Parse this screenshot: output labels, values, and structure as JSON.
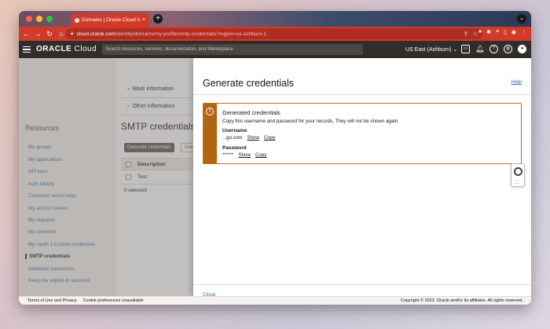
{
  "browser": {
    "tab_title": "Domains | Oracle Cloud Infrastr",
    "new_tab": "+",
    "tab_menu": "⌄",
    "url_host": "cloud.oracle.com",
    "url_path": "/identity/domains/my-profile/smtp-credentials?region=us-ashburn-1"
  },
  "header": {
    "logo_oracle": "ORACLE",
    "logo_cloud": "Cloud",
    "search_placeholder": "Search resources, services, documentation, and Marketplace",
    "region": "US East (Ashburn)"
  },
  "background_page": {
    "accordions": [
      "Work information",
      "Other information"
    ],
    "resources_title": "Resources",
    "sidebar_items": [
      "My groups",
      "My applications",
      "API keys",
      "Auth tokens",
      "Customer secret keys",
      "My access tokens",
      "My requests",
      "My consents",
      "My oauth 2.0 client credentials",
      "SMTP credentials",
      "Database passwords",
      "Keep me signed-in sessions"
    ],
    "active_item": "SMTP credentials",
    "section_title": "SMTP credentials",
    "generate_button": "Generate credentials",
    "delete_button": "Dele",
    "column_description": "Description",
    "row_description": "Test",
    "selected_text": "0 selected"
  },
  "drawer": {
    "title": "Generate credentials",
    "help": "Help",
    "alert": {
      "title": "Generated credentials",
      "description": "Copy this username and password for your records. They will not be shown again.",
      "username_label": "Username",
      "username_value": "...go.com",
      "password_label": "Password",
      "password_value": "******",
      "show": "Show",
      "copy": "Copy"
    },
    "close": "Close"
  },
  "footer": {
    "terms": "Terms of Use and Privacy",
    "cookies": "Cookie preferences unavailable",
    "copyright": "Copyright © 2023, Oracle and/or its affiliates. All rights reserved."
  },
  "colors": {
    "browser_red": "#d23a2a",
    "oracle_header": "#312d2a",
    "warning_orange": "#b36410",
    "link_blue": "#2f6ea5"
  }
}
